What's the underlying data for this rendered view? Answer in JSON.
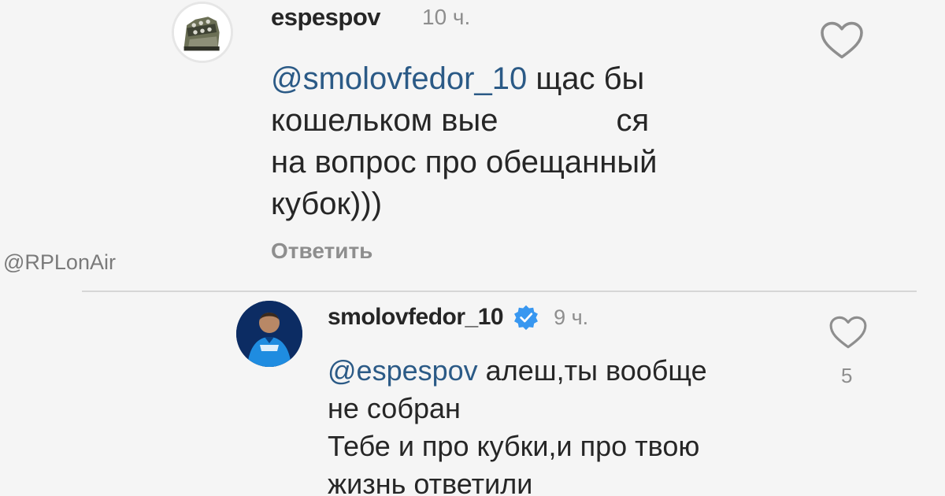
{
  "comments": [
    {
      "username": "espespov",
      "time": "10 ч.",
      "mention": "@smolovfedor_10",
      "lines": [
        "щас бы",
        "кошельком вые",
        "ся",
        "на вопрос про обещанный",
        "кубок)))"
      ],
      "reply_label": "Ответить",
      "avatar": "sneaker-avatar",
      "like_icon": "heart-outline-icon"
    },
    {
      "username": "smolovfedor_10",
      "verified": true,
      "time": "9 ч.",
      "mention": "@espespov",
      "lines": [
        "алеш,ты вообще",
        "не собран",
        "Тебе и про кубки,и про твою",
        "жизнь ответили"
      ],
      "like_icon": "heart-outline-icon",
      "like_count": "5",
      "avatar": "footballer-avatar"
    }
  ],
  "watermark": "@RPLonAir",
  "colors": {
    "mention": "#2b5a86",
    "verified_badge": "#3897f0",
    "secondary_text": "#8e8e8e"
  }
}
